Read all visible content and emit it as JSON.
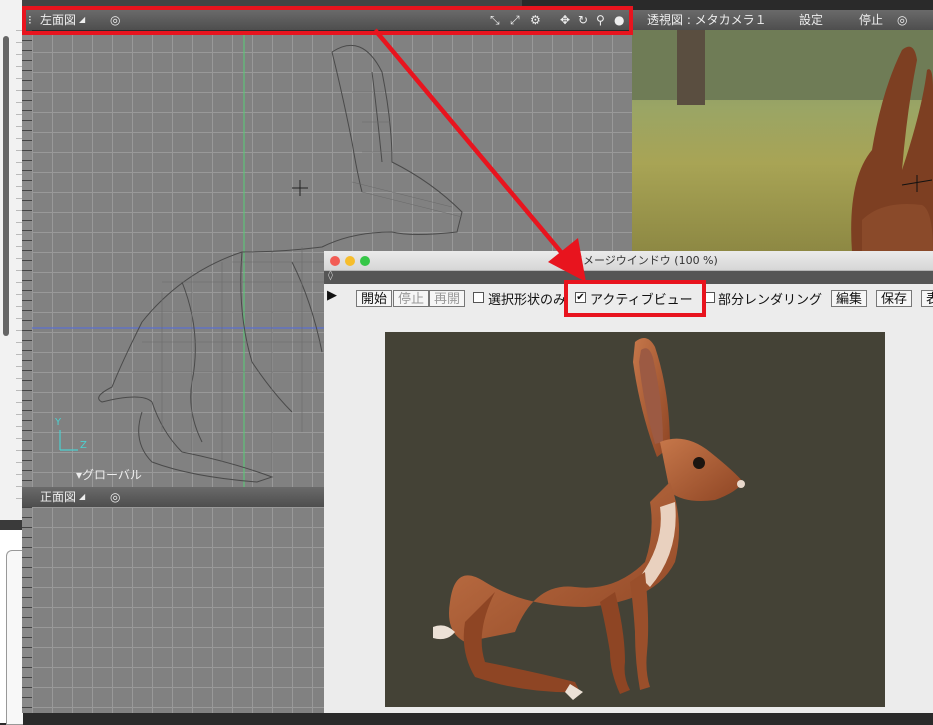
{
  "left_view": {
    "title": "左面図",
    "title_arrow": "◢",
    "target_icon": "◎",
    "icons": [
      "zoom-fit-icon",
      "zoom-select-icon",
      "gear-icon",
      "move-icon",
      "rotate-icon",
      "magnify-icon",
      "render-ball-icon"
    ],
    "axis_y": "Y",
    "axis_z": "Z",
    "coord_label": "▾グローバル"
  },
  "front_view": {
    "title": "正面図",
    "title_arrow": "◢",
    "target_icon": "◎"
  },
  "persp_view": {
    "title": "透視図 : メタカメラ１",
    "settings": "設定",
    "stop": "停止",
    "target_icon": "◎"
  },
  "image_window": {
    "title": "イメージウインドウ (100 %)",
    "play": "▶",
    "start": "開始",
    "stop": "停止",
    "restart": "再開",
    "selected_only": "選択形状のみ",
    "active_view": "アクティブビュー",
    "active_view_checked": true,
    "partial_render": "部分レンダリング",
    "edit": "編集",
    "save": "保存",
    "more": "表"
  },
  "colors": {
    "highlight": "#e8141e",
    "grid_bg": "#818181",
    "render_bg": "#444236",
    "hare": "#b8673f"
  }
}
